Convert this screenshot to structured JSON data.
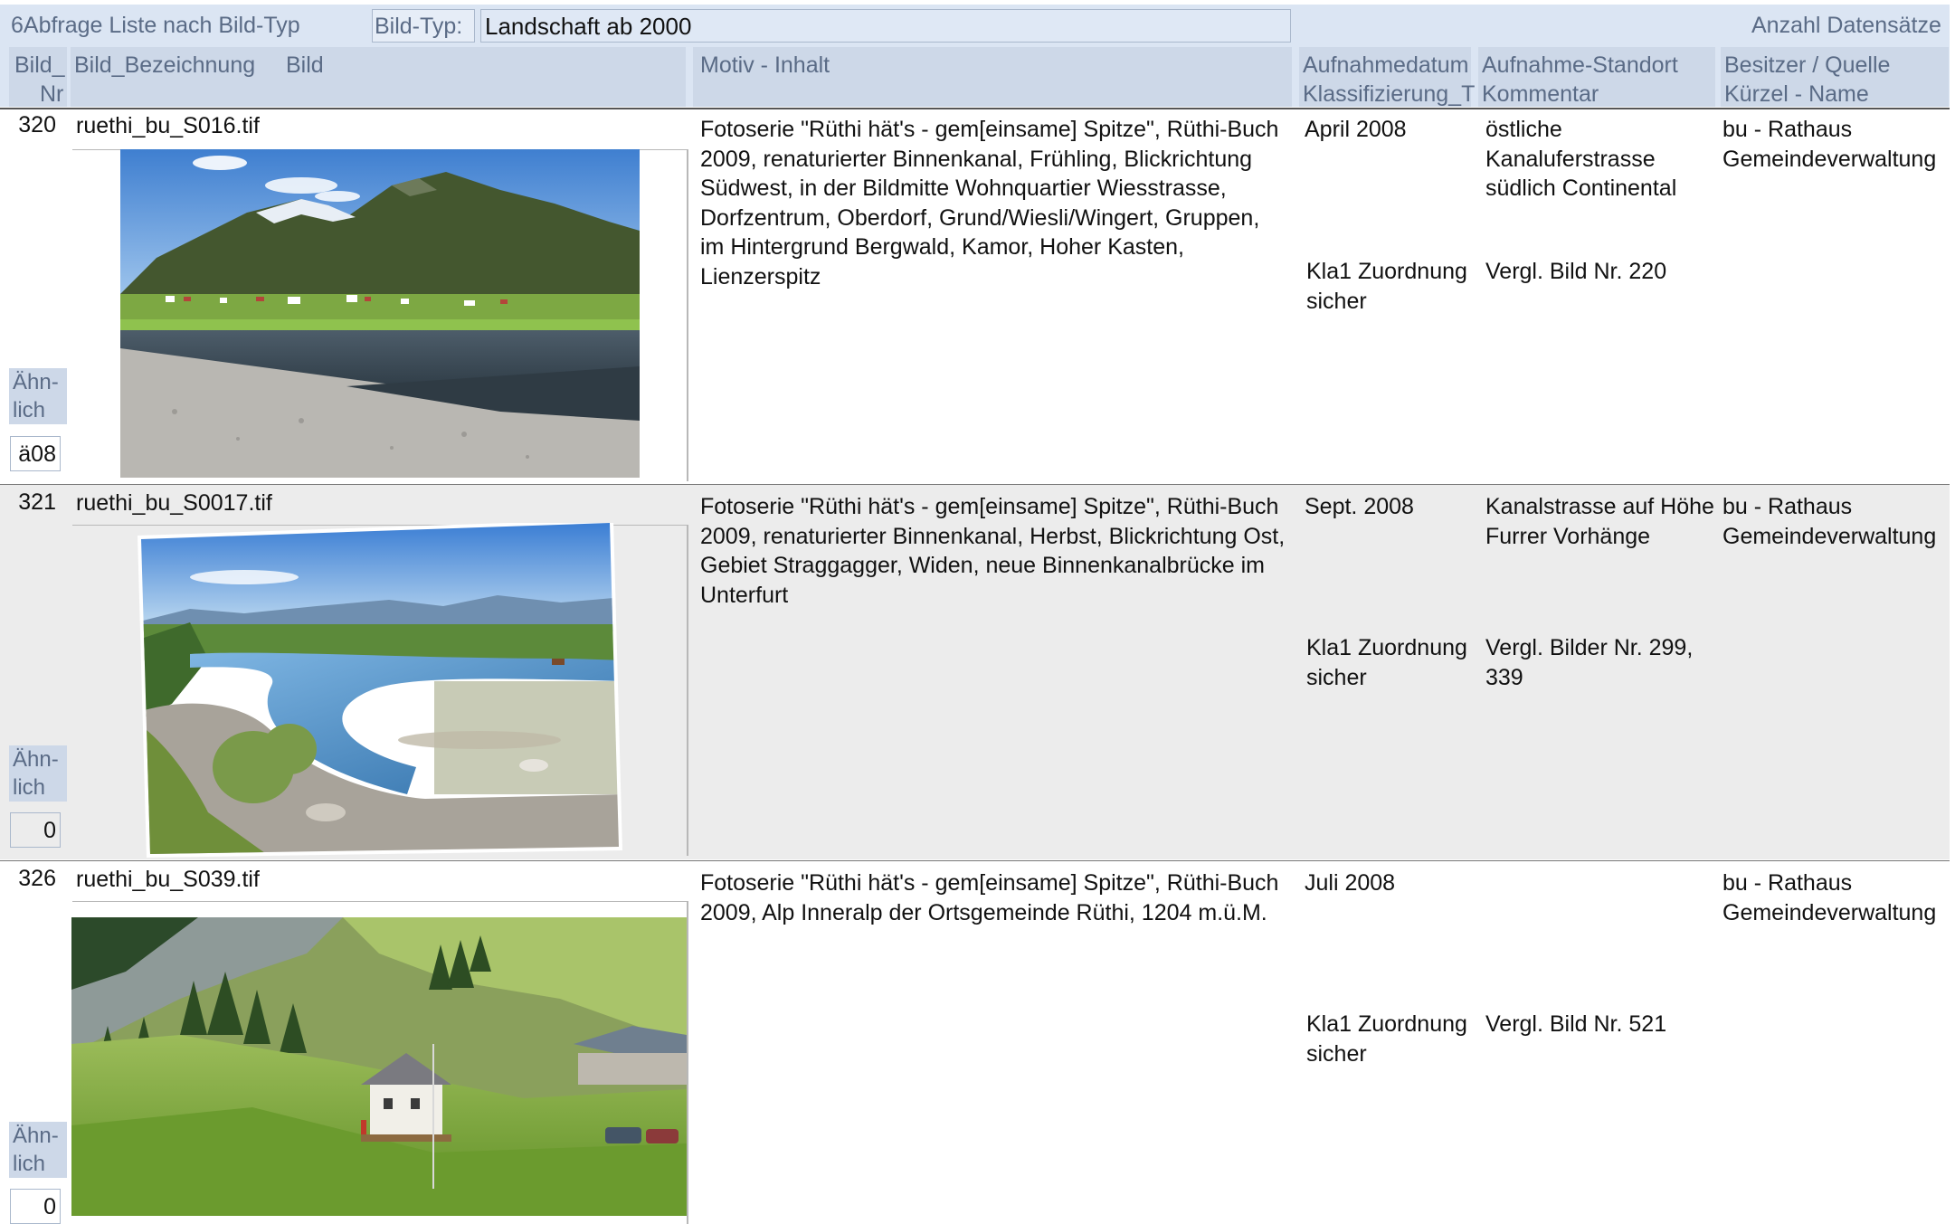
{
  "header": {
    "title": "6Abfrage Liste nach Bild-Typ",
    "bildtyp_label": "Bild-Typ:",
    "bildtyp_value": "Landschaft ab 2000",
    "count_label": "Anzahl Datensätze"
  },
  "columns": {
    "nr_1": "Bild_",
    "nr_2": "Nr",
    "bezeichnung": "Bild_Bezeichnung",
    "bild": "Bild",
    "motiv": "Motiv - Inhalt",
    "datum_1": "Aufnahmedatum",
    "datum_2": "Klassifizierung_T",
    "standort_1": "Aufnahme-Standort",
    "standort_2": "Kommentar",
    "besitzer_1": "Besitzer / Quelle",
    "besitzer_2": "Kürzel - Name"
  },
  "records": [
    {
      "nr": "320",
      "bezeichnung": "ruethi_bu_S016.tif",
      "motiv": "Fotoserie \"Rüthi hät's - gem[einsame] Spitze\", Rüthi-Buch 2009, renaturierter Binnenkanal, Frühling, Blickrichtung Südwest, in der Bildmitte Wohnquartier Wiesstrasse, Dorfzentrum, Oberdorf, Grund/Wiesli/Wingert, Gruppen, im Hintergrund Bergwald, Kamor, Hoher Kasten, Lienzerspitz",
      "datum": "April 2008",
      "klass": "Kla1 Zuordnung sicher",
      "standort": "östliche Kanaluferstrasse südlich Continental",
      "kommentar": "Vergl. Bild Nr. 220",
      "besitzer_1": "bu - Rathaus",
      "besitzer_2": "Gemeindeverwaltung",
      "aehn_label": "Ähn-lich",
      "aehn_value": "ä08"
    },
    {
      "nr": "321",
      "bezeichnung": "ruethi_bu_S0017.tif",
      "motiv": "Fotoserie \"Rüthi hät's - gem[einsame] Spitze\", Rüthi-Buch 2009, renaturierter Binnenkanal, Herbst, Blickrichtung Ost, Gebiet Straggagger, Widen, neue Binnenkanalbrücke im Unterfurt",
      "datum": "Sept. 2008",
      "klass": "Kla1 Zuordnung sicher",
      "standort": "Kanalstrasse auf Höhe Furrer Vorhänge",
      "kommentar": "Vergl. Bilder Nr. 299, 339",
      "besitzer_1": "bu - Rathaus",
      "besitzer_2": "Gemeindeverwaltung",
      "aehn_label": "Ähn-lich",
      "aehn_value": "0"
    },
    {
      "nr": "326",
      "bezeichnung": "ruethi_bu_S039.tif",
      "motiv": "Fotoserie \"Rüthi hät's - gem[einsame] Spitze\", Rüthi-Buch 2009, Alp Inneralp der Ortsgemeinde Rüthi, 1204 m.ü.M.",
      "datum": "Juli 2008",
      "klass": "Kla1 Zuordnung sicher",
      "standort": "",
      "kommentar": "Vergl. Bild Nr. 521",
      "besitzer_1": "bu - Rathaus",
      "besitzer_2": "Gemeindeverwaltung",
      "aehn_label": "Ähn-lich",
      "aehn_value": "0"
    }
  ]
}
